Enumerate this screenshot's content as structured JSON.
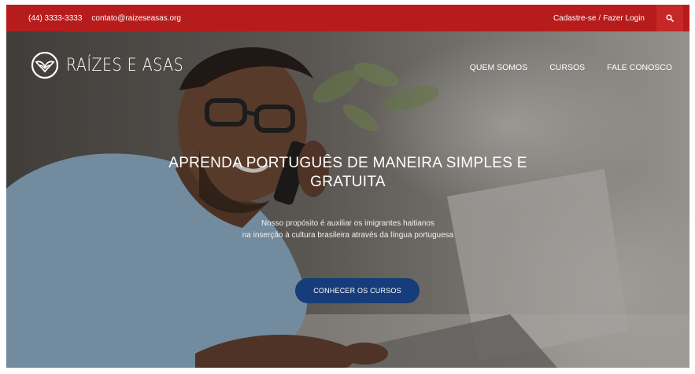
{
  "topbar": {
    "phone": "(44) 3333-3333",
    "email": "contato@raizeseasas.org",
    "signup": "Cadastre-se",
    "separator": "/",
    "login": "Fazer Login",
    "search_icon": "search-icon"
  },
  "header": {
    "logo_text": "RAÍZES E ASAS",
    "logo_icon": "wings-emblem-icon",
    "nav": [
      "QUEM SOMOS",
      "CURSOS",
      "FALE CONOSCO"
    ]
  },
  "hero": {
    "title_line1": "APRENDA PORTUGUÊS DE MANEIRA SIMPLES E",
    "title_line2": "GRATUITA",
    "subtitle_line1": "Nosso propósito é auxiliar os imigrantes haitianos",
    "subtitle_line2": "na inserção à cultura brasileira através da língua portuguesa",
    "cta": "CONHECER OS CURSOS"
  },
  "colors": {
    "topbar": "#b71c1c",
    "search_button": "#c62828",
    "cta": "#173c7a"
  }
}
